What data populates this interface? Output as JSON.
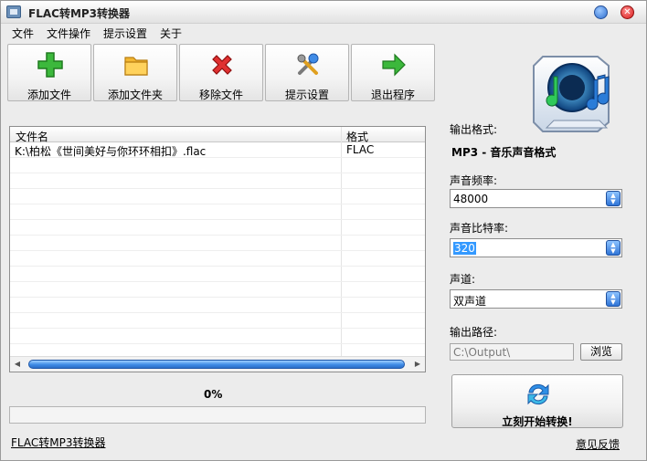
{
  "window": {
    "title": "FLAC转MP3转换器"
  },
  "menu": [
    "文件",
    "文件操作",
    "提示设置",
    "关于"
  ],
  "toolbar": [
    {
      "label": "添加文件",
      "icon": "add-plus-icon"
    },
    {
      "label": "添加文件夹",
      "icon": "folder-icon"
    },
    {
      "label": "移除文件",
      "icon": "remove-x-icon"
    },
    {
      "label": "提示设置",
      "icon": "tools-icon"
    },
    {
      "label": "退出程序",
      "icon": "exit-arrow-icon"
    }
  ],
  "filelist": {
    "columns": {
      "name": "文件名",
      "format": "格式"
    },
    "rows": [
      {
        "name": "K:\\柏松《世间美好与你环环相扣》.flac",
        "format": "FLAC"
      }
    ]
  },
  "progress": {
    "percent_text": "0%",
    "value": 0
  },
  "settings": {
    "output_format_label": "输出格式:",
    "output_format_value": "MP3 - 音乐声音格式",
    "sample_rate_label": "声音频率:",
    "sample_rate_value": "48000",
    "bitrate_label": "声音比特率:",
    "bitrate_value": "320",
    "channel_label": "声道:",
    "channel_value": "双声道",
    "output_path_label": "输出路径:",
    "output_path_value": "C:\\Output\\",
    "browse_label": "浏览"
  },
  "start_button": {
    "label": "立刻开始转换!"
  },
  "footer": {
    "app_link": "FLAC转MP3转换器",
    "feedback_link": "意见反馈"
  },
  "colors": {
    "accent": "#2f74d6",
    "selection": "#3399ff"
  }
}
